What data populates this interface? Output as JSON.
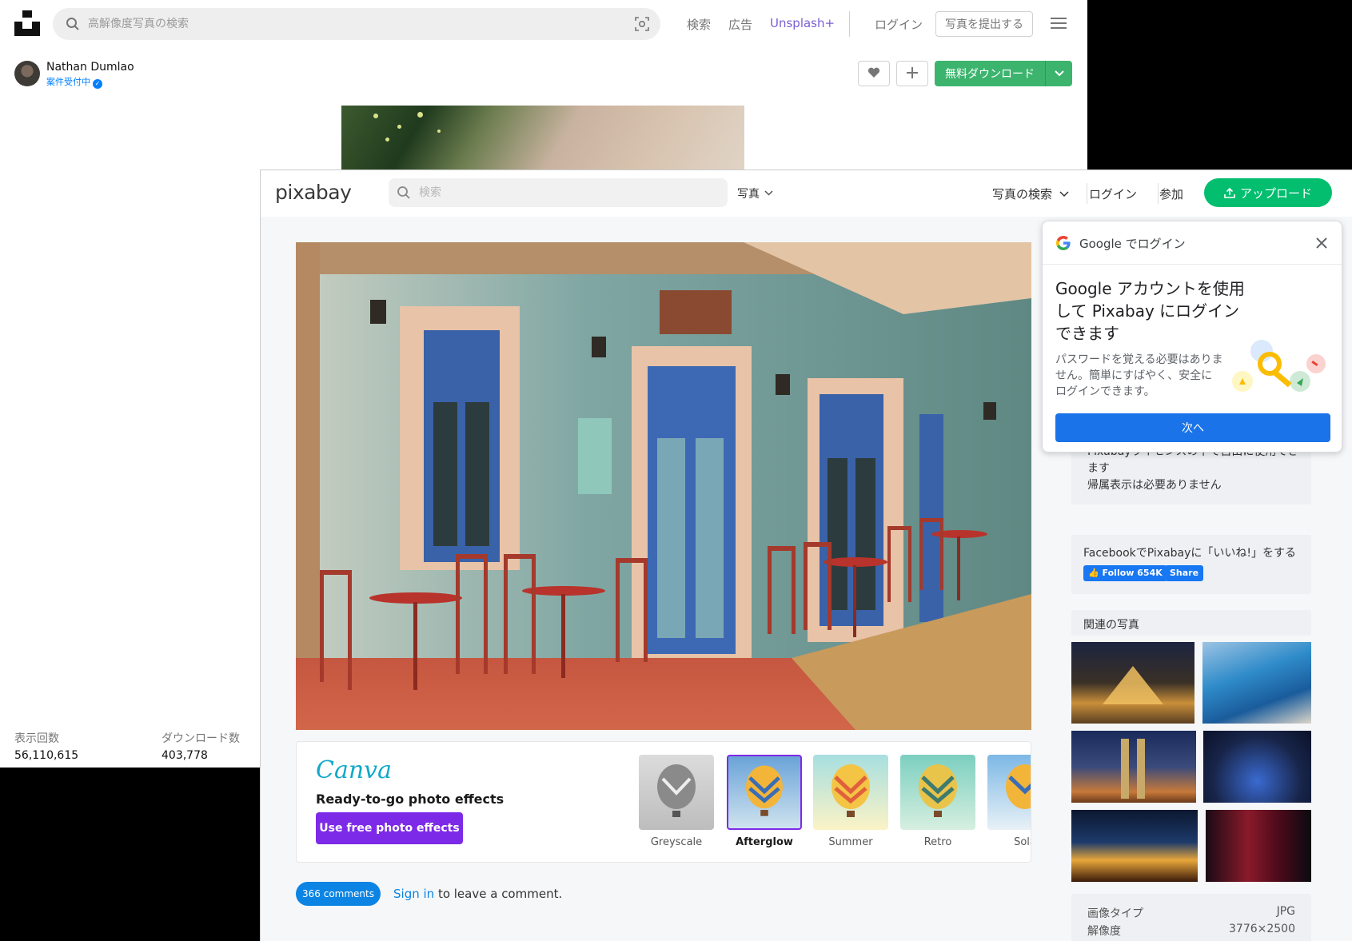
{
  "unsplash": {
    "search_placeholder": "高解像度写真の検索",
    "nav": {
      "search": "検索",
      "ads": "広告",
      "plus": "Unsplash+"
    },
    "login": "ログイン",
    "submit_photo": "写真を提出する",
    "author": {
      "name": "Nathan Dumlao",
      "status": "案件受付中"
    },
    "download_label": "無料ダウンロード",
    "stats": {
      "views_label": "表示回数",
      "views_value": "56,110,615",
      "downloads_label": "ダウンロード数",
      "downloads_value": "403,778"
    }
  },
  "pixabay": {
    "logo": "pixabay",
    "search_placeholder": "検索",
    "type_select": "写真",
    "nav": {
      "explore": "写真の検索",
      "login": "ログイン",
      "join": "参加"
    },
    "upload": "アップロード",
    "canva": {
      "logo": "Canva",
      "title": "Ready-to-go photo effects",
      "button": "Use free photo effects",
      "effects": [
        "Greyscale",
        "Afterglow",
        "Summer",
        "Retro",
        "Sola"
      ],
      "selected": "Afterglow"
    },
    "comments": {
      "count_label": "366 comments",
      "signin_link": "Sign in",
      "signin_rest": " to leave a comment."
    },
    "license": {
      "line1": "Pixabayライセンスの下で自由に使用できます",
      "line2": "帰属表示は必要ありません"
    },
    "facebook": {
      "text": "FacebookでPixabayに「いいね!」をする",
      "follow": "Follow 654K",
      "share": "Share"
    },
    "related_title": "関連の写真",
    "meta": {
      "type_label": "画像タイプ",
      "type_value": "JPG",
      "resolution_label": "解像度",
      "resolution_value": "3776×2500"
    }
  },
  "google_popup": {
    "header": "Google でログイン",
    "title": "Google アカウントを使用して Pixabay にログインできます",
    "description": "パスワードを覚える必要はありません。簡単にすばやく、安全にログインできます。",
    "next_button": "次へ"
  },
  "colors": {
    "unsplash_green": "#3cb46e",
    "unsplash_plus_purple": "#7c5fd1",
    "pixabay_green": "#02be6e",
    "pixabay_blue": "#0c84e4",
    "canva_purple": "#7d2ae8",
    "google_blue": "#1a73e8",
    "facebook_blue": "#1877f2"
  },
  "icons": [
    "unsplash-logo-icon",
    "search-icon",
    "visual-search-icon",
    "menu-icon",
    "heart-icon",
    "plus-icon",
    "chevron-down-icon",
    "verified-icon",
    "upload-icon",
    "google-logo-icon",
    "close-icon",
    "key-illustration-icon",
    "facebook-like-icon"
  ]
}
